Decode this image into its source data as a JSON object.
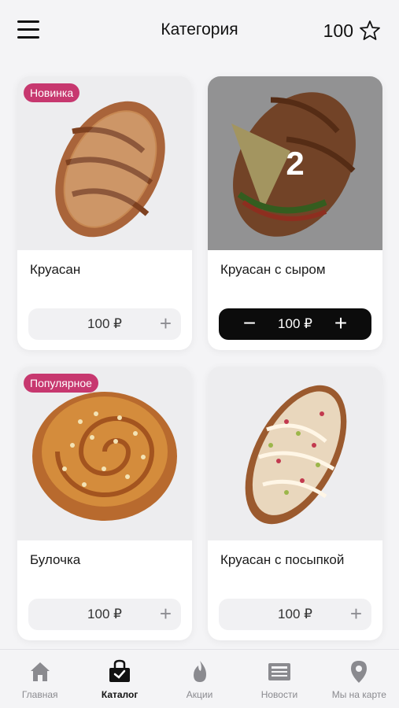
{
  "header": {
    "title": "Категория",
    "points": "100",
    "menu_icon": "hamburger-menu-icon",
    "points_icon": "star-icon"
  },
  "products": [
    {
      "name": "Круасан",
      "price": "100 ₽",
      "badge": "Новинка",
      "in_cart": false,
      "quantity": null,
      "image": "croissant"
    },
    {
      "name": "Круасан с сыром",
      "price": "100 ₽",
      "badge": null,
      "in_cart": true,
      "quantity": "2",
      "image": "croissant-with-cheese"
    },
    {
      "name": "Булочка",
      "price": "100 ₽",
      "badge": "Популярное",
      "in_cart": false,
      "quantity": null,
      "image": "bun"
    },
    {
      "name": "Круасан с посыпкой",
      "price": "100 ₽",
      "badge": null,
      "in_cart": false,
      "quantity": null,
      "image": "croissant-with-topping"
    }
  ],
  "controls": {
    "plus": "+",
    "minus": "−"
  },
  "nav": [
    {
      "label": "Главная",
      "icon": "home-icon",
      "active": false
    },
    {
      "label": "Каталог",
      "icon": "catalog-bag-icon",
      "active": true
    },
    {
      "label": "Акции",
      "icon": "flame-icon",
      "active": false
    },
    {
      "label": "Новости",
      "icon": "news-icon",
      "active": false
    },
    {
      "label": "Мы на карте",
      "icon": "map-pin-icon",
      "active": false
    }
  ],
  "colors": {
    "badge": "#c7386f",
    "accent_dark": "#0c0c0c",
    "background": "#f4f4f6"
  }
}
